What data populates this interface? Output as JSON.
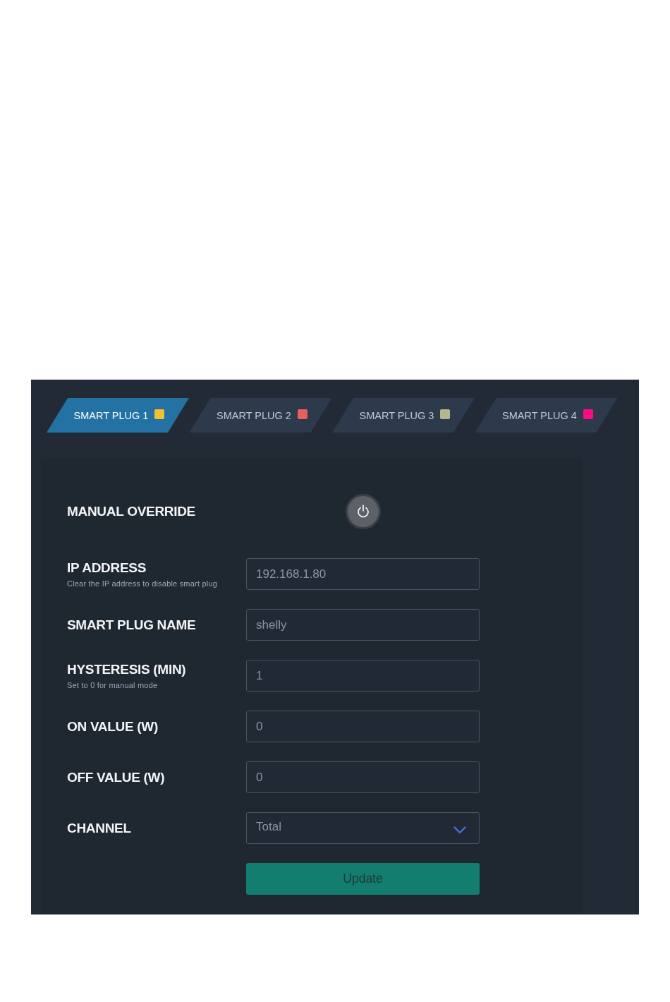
{
  "tabs": [
    {
      "label": "SMART PLUG 1",
      "color": "#f2c12e",
      "selected": true
    },
    {
      "label": "SMART PLUG 2",
      "color": "#e8605a",
      "selected": false
    },
    {
      "label": "SMART PLUG 3",
      "color": "#b4b88c",
      "selected": false
    },
    {
      "label": "SMART PLUG 4",
      "color": "#ff0a82",
      "selected": false
    }
  ],
  "manual_override": {
    "label": "MANUAL OVERRIDE",
    "on": false
  },
  "fields": [
    {
      "kind": "text",
      "label": "IP ADDRESS",
      "hint": "Clear the IP address to disable smart plug",
      "value": "192.168.1.80"
    },
    {
      "kind": "text",
      "label": "SMART PLUG NAME",
      "value": "shelly"
    },
    {
      "kind": "text",
      "label": "HYSTERESIS (MIN)",
      "hint": "Set to 0 for manual mode",
      "value": "1"
    },
    {
      "kind": "text",
      "label": "ON VALUE (W)",
      "value": "0"
    },
    {
      "kind": "text",
      "label": "OFF VALUE (W)",
      "value": "0"
    },
    {
      "kind": "select",
      "label": "CHANNEL",
      "value": "Total"
    }
  ],
  "update_button": {
    "label": "Update"
  }
}
